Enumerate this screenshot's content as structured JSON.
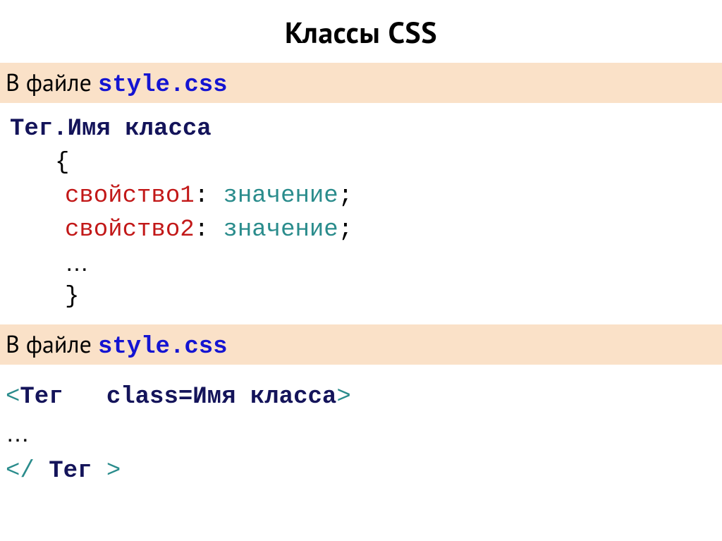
{
  "title": "Классы CSS",
  "banner1": {
    "prefix": "В файле ",
    "file": "style.css"
  },
  "css": {
    "selector_tag": "Тег",
    "dot": ".",
    "selector_class": "Имя класса",
    "open": "{",
    "prop1": "свойство1",
    "prop2": "свойство2",
    "colon": ":",
    "value": "значение",
    "semi": ";",
    "ellipsis": "…",
    "close": "}"
  },
  "banner2": {
    "prefix": "В файле ",
    "file": "style.css"
  },
  "html": {
    "open_lt": "<",
    "tag": "Тег",
    "space3": "   ",
    "class_kw": "class=",
    "class_val": "Имя класса",
    "gt": ">",
    "ellipsis": "…",
    "close_open": "</ ",
    "close_tag": "Тег",
    "close_gt": " >"
  }
}
